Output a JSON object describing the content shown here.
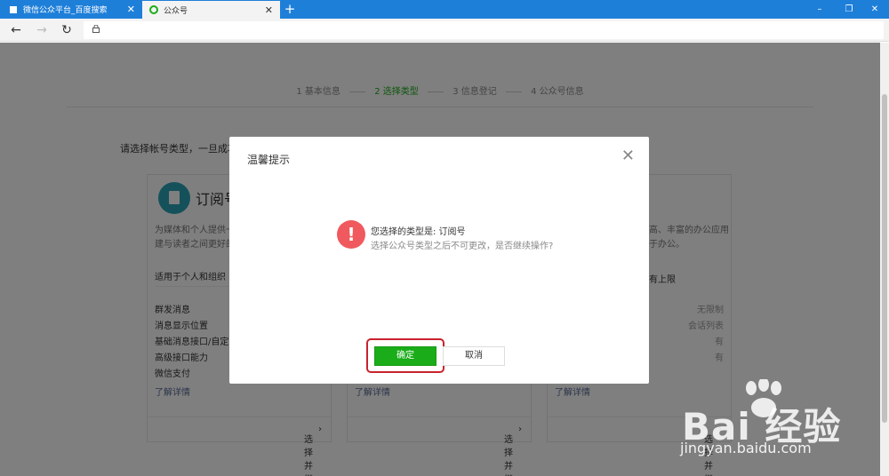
{
  "browser": {
    "tabs": [
      {
        "label": "微信公众平台_百度搜索"
      },
      {
        "label": "公众号"
      }
    ],
    "window_controls": [
      "–",
      "❐",
      "✕"
    ]
  },
  "page": {
    "steps": [
      "1 基本信息",
      "2 选择类型",
      "3 信息登记",
      "4 公众号信息"
    ],
    "intro": "请选择帐号类型，一旦成功",
    "cards": [
      {
        "name": "订阅号",
        "desc_lines": [
          "为媒体和个人提供一",
          "建与读者之间更好的"
        ],
        "fit": "适用于个人和组织",
        "features": [
          "群发消息",
          "消息显示位置",
          "基础消息接口/自定义",
          "高级接口能力",
          "微信支付"
        ],
        "more": "了解详情",
        "select": "选择并继续"
      },
      {
        "more": "了解详情",
        "select": "选择并继续"
      },
      {
        "desc_lines": [
          "高、丰富的办公应用",
          "于办公。"
        ],
        "fit": "有上限",
        "feature_values": [
          "无限制",
          "会话列表",
          "有",
          "有"
        ],
        "more": "了解详情",
        "select": "选择并继续"
      }
    ]
  },
  "dialog": {
    "title": "温馨提示",
    "message": "您选择的类型是: 订阅号",
    "sub_message": "选择公众号类型之后不可更改，是否继续操作?",
    "ok_label": "确定",
    "cancel_label": "取消"
  },
  "watermark": {
    "logo": "Bai 经验",
    "url": "jingyan.baidu.com"
  },
  "colors": {
    "tabbar": "#1e7fd9",
    "primary_green": "#1aad19",
    "alert_red": "#f0595d",
    "highlight_red": "#c8232d"
  }
}
